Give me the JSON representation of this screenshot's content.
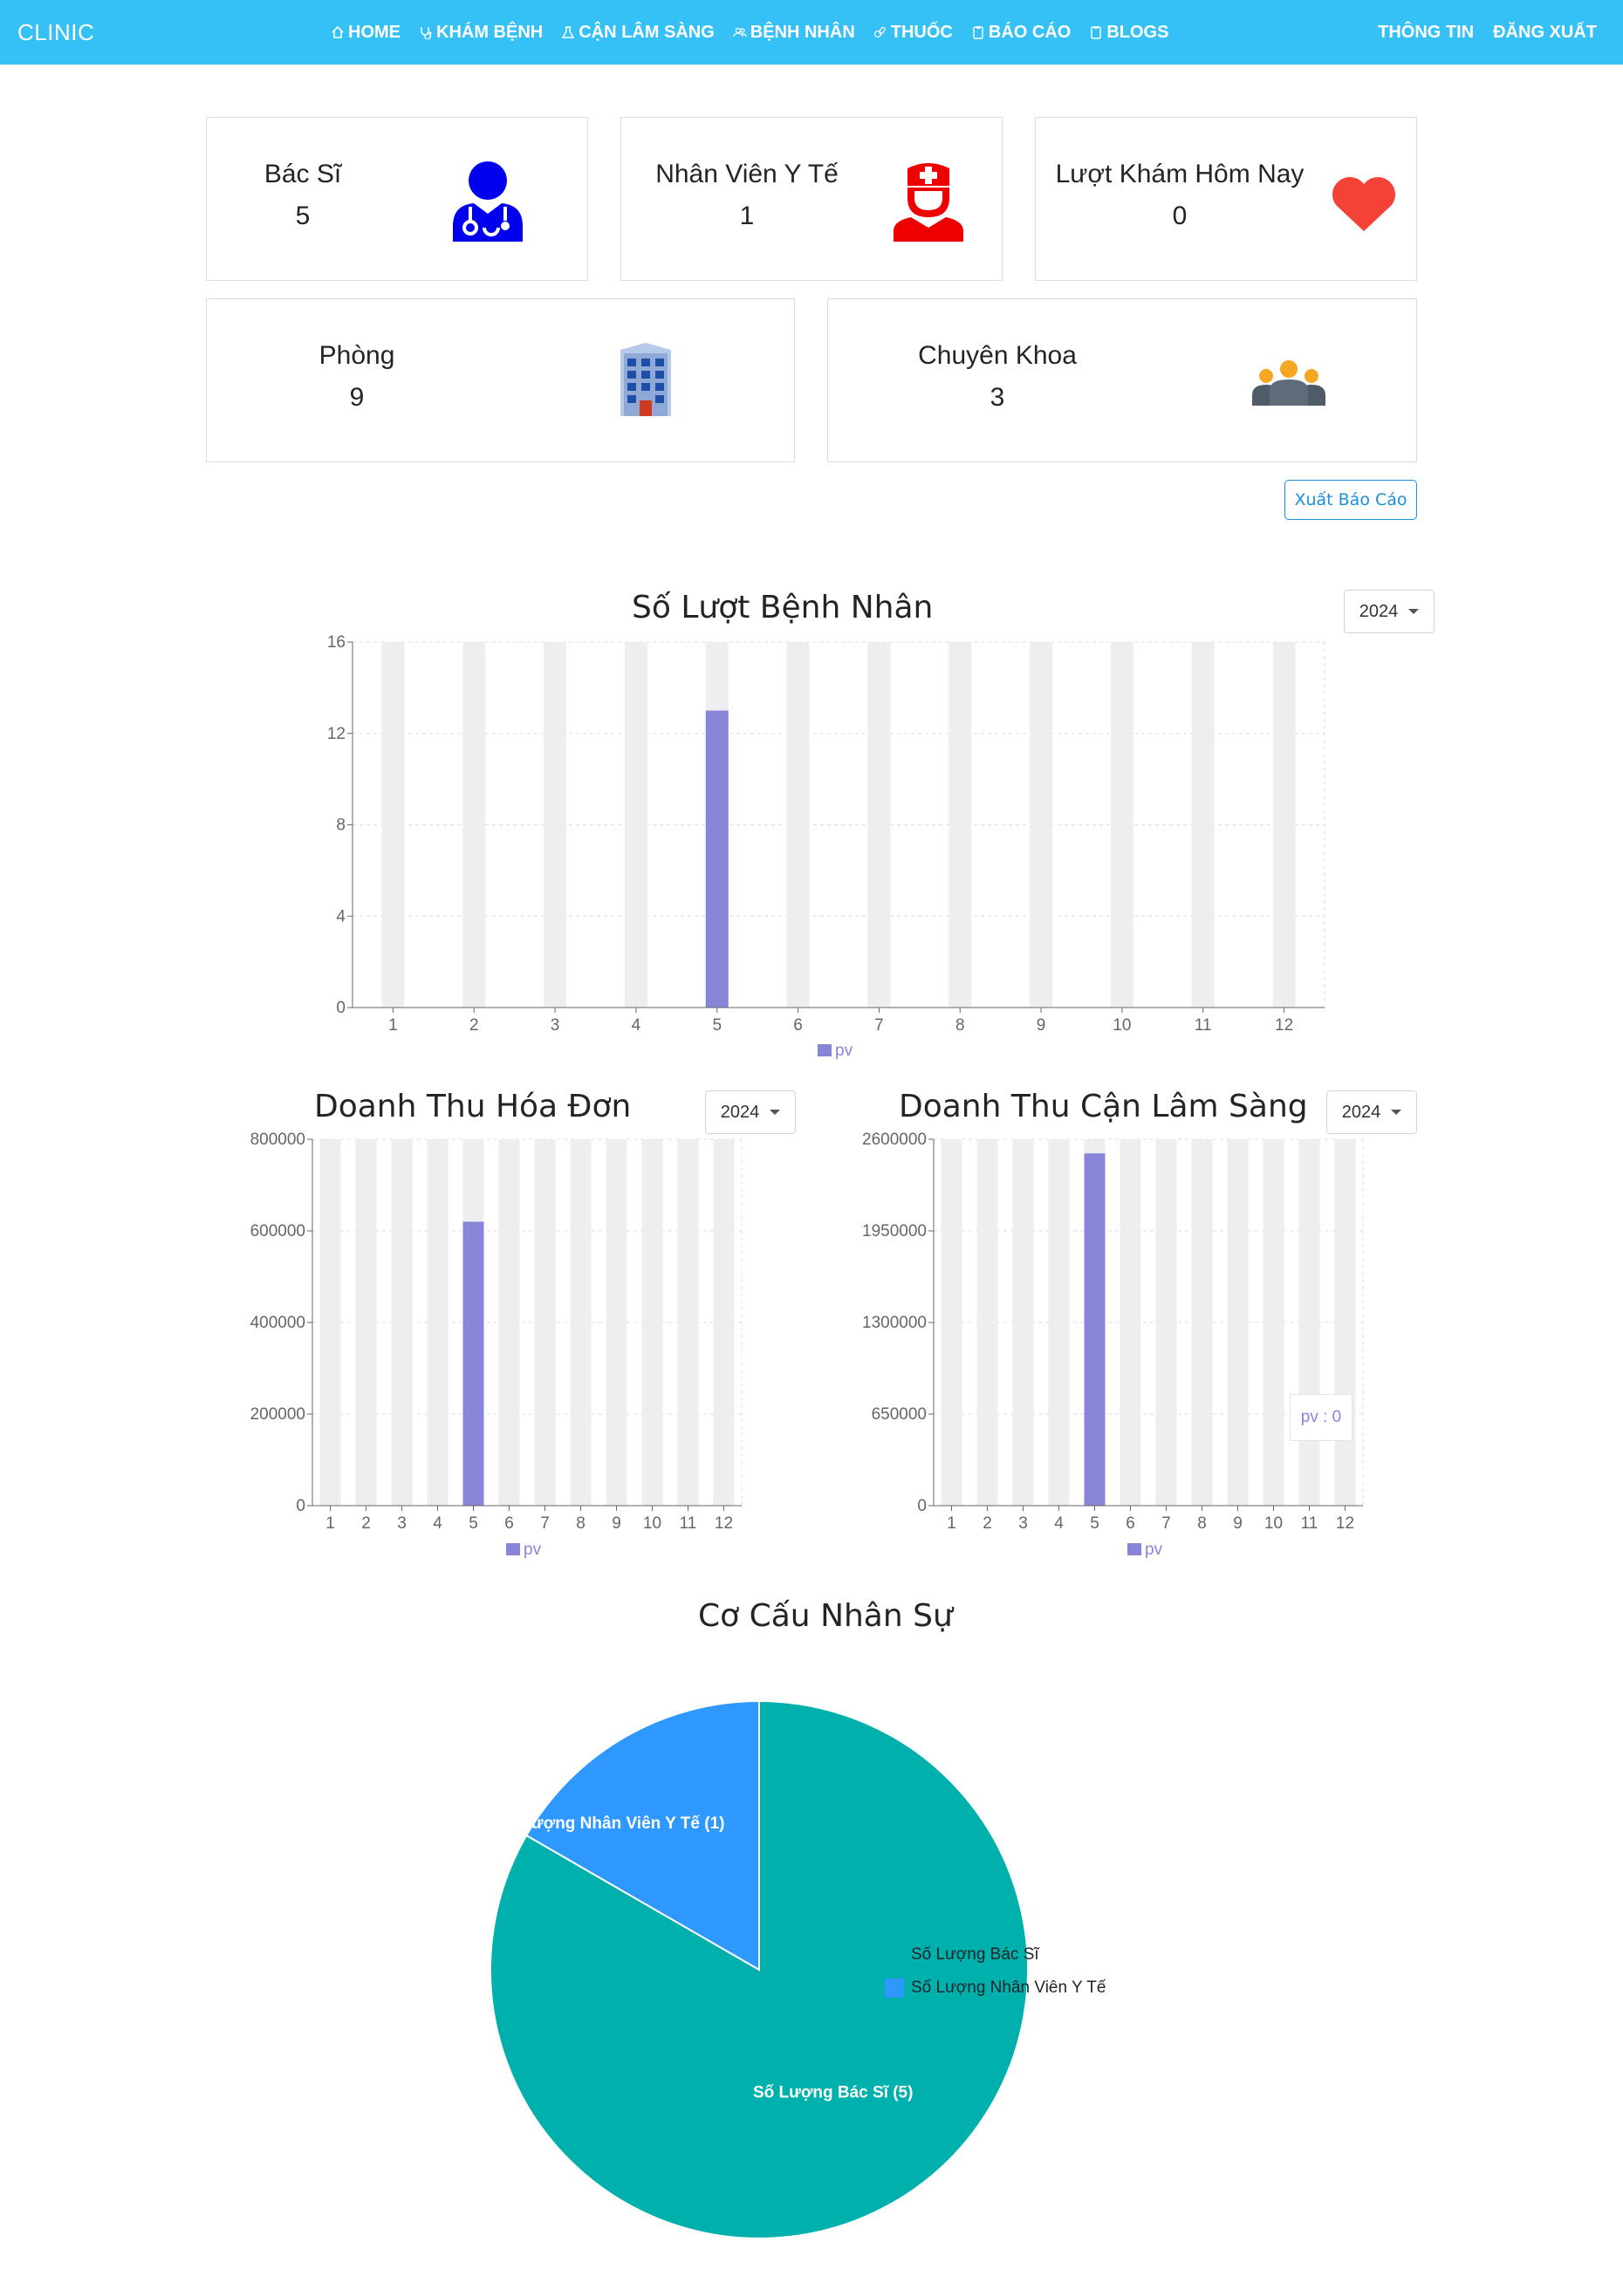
{
  "navbar": {
    "brand": "CLINIC",
    "center_links": [
      {
        "label": "HOME",
        "icon": "home-icon"
      },
      {
        "label": "KHÁM BỆNH",
        "icon": "stethoscope-icon"
      },
      {
        "label": "CẬN LÂM SÀNG",
        "icon": "flask-icon"
      },
      {
        "label": "BỆNH NHÂN",
        "icon": "users-icon"
      },
      {
        "label": "THUỐC",
        "icon": "pills-icon"
      },
      {
        "label": "BÁO CÁO",
        "icon": "clipboard-icon"
      },
      {
        "label": "BLOGS",
        "icon": "clipboard-icon"
      }
    ],
    "right_links": [
      {
        "label": "THÔNG TIN"
      },
      {
        "label": "ĐĂNG XUẤT"
      }
    ]
  },
  "stats": {
    "doctors": {
      "label": "Bác Sĩ",
      "value": "5",
      "icon": "doctor-icon",
      "color": "#0000ee"
    },
    "staff": {
      "label": "Nhân Viên Y Tế",
      "value": "1",
      "icon": "nurse-icon",
      "color": "#ee0000"
    },
    "visits_today": {
      "label": "Lượt Khám Hôm Nay",
      "value": "0",
      "icon": "heart-icon",
      "color": "#f44336"
    },
    "rooms": {
      "label": "Phòng",
      "value": "9",
      "icon": "hospital-building-icon"
    },
    "specialties": {
      "label": "Chuyên Khoa",
      "value": "3",
      "icon": "group-icon"
    }
  },
  "export_button": "Xuất Báo Cáo",
  "colors": {
    "accent": "#35c0f6",
    "bar": "#8884d8",
    "bar_background": "#eeeeee",
    "pie_doctors": "#00b0ad",
    "pie_staff": "#2e98ff"
  },
  "charts": {
    "patients": {
      "title": "Số Lượt Bệnh Nhân",
      "year": "2024",
      "tooltip": ""
    },
    "invoice_revenue": {
      "title": "Doanh Thu Hóa Đơn",
      "year": "2024",
      "tooltip": ""
    },
    "clinical_revenue": {
      "title": "Doanh Thu Cận Lâm Sàng",
      "year": "2024",
      "tooltip": "pv : 0"
    },
    "staff_structure": {
      "title": "Cơ Cấu Nhân Sự"
    }
  },
  "chart_data": [
    {
      "type": "bar",
      "title": "Số Lượt Bệnh Nhân",
      "categories": [
        "1",
        "2",
        "3",
        "4",
        "5",
        "6",
        "7",
        "8",
        "9",
        "10",
        "11",
        "12"
      ],
      "series": [
        {
          "name": "pv",
          "values": [
            0,
            0,
            0,
            0,
            13,
            0,
            0,
            0,
            0,
            0,
            0,
            0
          ]
        }
      ],
      "yticks": [
        "0",
        "4",
        "8",
        "12",
        "16"
      ],
      "ylim": [
        0,
        16
      ],
      "grid": true,
      "legend": "bottom"
    },
    {
      "type": "bar",
      "title": "Doanh Thu Hóa Đơn",
      "categories": [
        "1",
        "2",
        "3",
        "4",
        "5",
        "6",
        "7",
        "8",
        "9",
        "10",
        "11",
        "12"
      ],
      "series": [
        {
          "name": "pv",
          "values": [
            0,
            0,
            0,
            0,
            620000,
            0,
            0,
            0,
            0,
            0,
            0,
            0
          ]
        }
      ],
      "yticks": [
        "0",
        "200000",
        "400000",
        "600000",
        "800000"
      ],
      "ylim": [
        0,
        800000
      ],
      "grid": true,
      "legend": "bottom"
    },
    {
      "type": "bar",
      "title": "Doanh Thu Cận Lâm Sàng",
      "categories": [
        "1",
        "2",
        "3",
        "4",
        "5",
        "6",
        "7",
        "8",
        "9",
        "10",
        "11",
        "12"
      ],
      "series": [
        {
          "name": "pv",
          "values": [
            0,
            0,
            0,
            0,
            2500000,
            0,
            0,
            0,
            0,
            0,
            0,
            0
          ]
        }
      ],
      "yticks": [
        "0",
        "650000",
        "1300000",
        "1950000",
        "2600000"
      ],
      "ylim": [
        0,
        2600000
      ],
      "grid": true,
      "legend": "bottom"
    },
    {
      "type": "pie",
      "title": "Cơ Cấu Nhân Sự",
      "slices": [
        {
          "name": "Số Lượng Bác Sĩ",
          "value": 5,
          "label": "Số Lượng Bác Sĩ (5)",
          "color": "#00b0ad"
        },
        {
          "name": "Số Lượng Nhân Viên Y Tế",
          "value": 1,
          "label": "Số Lượng Nhân Viên Y Tế (1)",
          "color": "#2e98ff"
        }
      ],
      "legend": "right"
    }
  ]
}
